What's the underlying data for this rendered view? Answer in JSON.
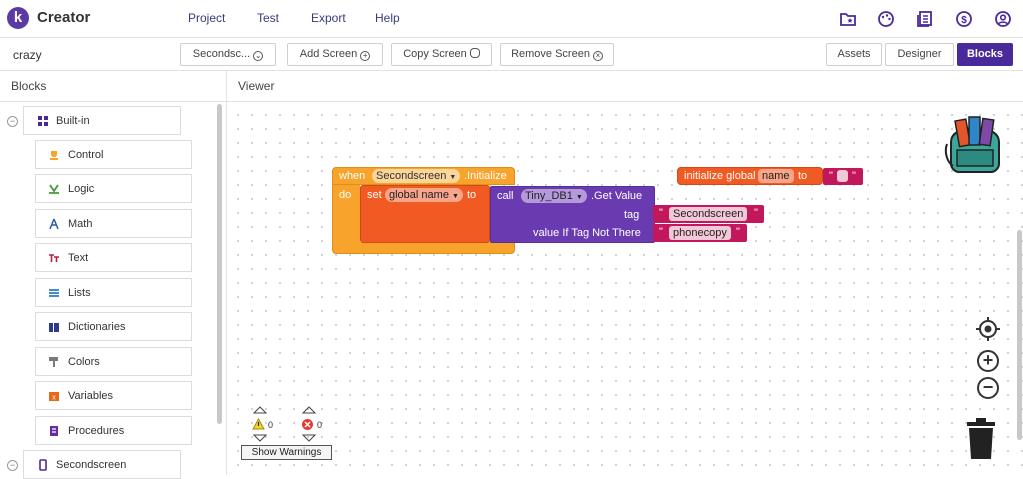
{
  "app": {
    "title": "Creator",
    "logo_letter": "k"
  },
  "menu": {
    "items": [
      "Project",
      "Test",
      "Export",
      "Help"
    ]
  },
  "top_icons": [
    "folder-star-icon",
    "palette-icon",
    "gallery-icon",
    "dollar-icon",
    "account-icon"
  ],
  "project": {
    "name": "crazy",
    "screen_selector": "Secondsc...",
    "add_screen": "Add Screen",
    "copy_screen": "Copy Screen",
    "remove_screen": "Remove Screen",
    "assets": "Assets",
    "designer": "Designer",
    "blocks": "Blocks"
  },
  "panels": {
    "blocks_title": "Blocks",
    "viewer_title": "Viewer"
  },
  "palette": {
    "builtin": "Built-in",
    "items": [
      "Control",
      "Logic",
      "Math",
      "Text",
      "Lists",
      "Dictionaries",
      "Colors",
      "Variables",
      "Procedures"
    ],
    "screen": "Secondscreen"
  },
  "colors": {
    "accent": "#4a2a9a",
    "control": "#f8a32b",
    "logic": "#3f9b3a",
    "math": "#2d5ea8",
    "text": "#b0243f",
    "lists": "#2a7dbf",
    "dictionaries": "#2d3b8f",
    "colors": "#7a7a7a",
    "variables": "#e8681c",
    "procedures": "#6a2aa0",
    "component": "#6a3bb0",
    "string": "#c2185b"
  },
  "workspace": {
    "event_block": {
      "when": "when",
      "component": "Secondscreen",
      "event": ".Initialize",
      "do": "do"
    },
    "set_block": {
      "set": "set",
      "variable": "global name",
      "to": "to"
    },
    "call_block": {
      "call": "call",
      "component": "Tiny_DB1",
      "method": ".Get Value",
      "tag_label": "tag",
      "tag_value": "Secondscreen",
      "default_label": "value If Tag Not There",
      "default_value": "phonecopy"
    },
    "global_block": {
      "initialize": "initialize global",
      "name": "name",
      "to": "to"
    },
    "quote": "\"",
    "warnings_count": "0",
    "errors_count": "0",
    "show_warnings": "Show Warnings"
  }
}
